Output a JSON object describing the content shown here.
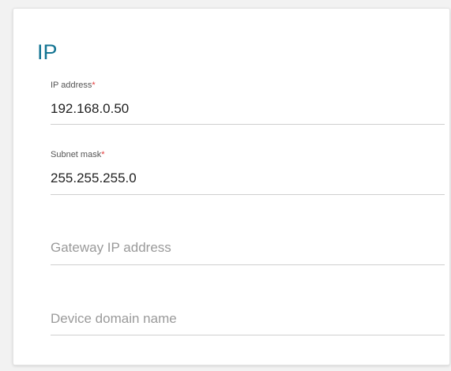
{
  "section": {
    "title": "IP"
  },
  "fields": {
    "ip_address": {
      "label": "IP address",
      "required_mark": "*",
      "value": "192.168.0.50"
    },
    "subnet_mask": {
      "label": "Subnet mask",
      "required_mark": "*",
      "value": "255.255.255.0"
    },
    "gateway": {
      "placeholder": "Gateway IP address",
      "value": ""
    },
    "domain": {
      "placeholder": "Device domain name",
      "value": ""
    }
  },
  "colors": {
    "title": "#147593",
    "required": "#e23b3b",
    "underline": "#cfcfcf",
    "background": "#f2f2f2",
    "card": "#ffffff"
  }
}
